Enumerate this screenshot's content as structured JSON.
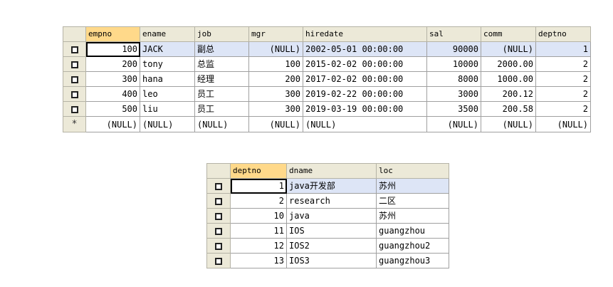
{
  "emp": {
    "columns": [
      "empno",
      "ename",
      "job",
      "mgr",
      "hiredate",
      "sal",
      "comm",
      "deptno"
    ],
    "rows": [
      [
        "100",
        "JACK",
        "副总",
        "(NULL)",
        "2002-05-01 00:00:00",
        "90000",
        "(NULL)",
        "1"
      ],
      [
        "200",
        "tony",
        "总监",
        "100",
        "2015-02-02 00:00:00",
        "10000",
        "2000.00",
        "2"
      ],
      [
        "300",
        "hana",
        "经理",
        "200",
        "2017-02-02 00:00:00",
        "8000",
        "1000.00",
        "2"
      ],
      [
        "400",
        "leo",
        "员工",
        "300",
        "2019-02-22 00:00:00",
        "3000",
        "200.12",
        "2"
      ],
      [
        "500",
        "liu",
        "员工",
        "300",
        "2019-03-19 00:00:00",
        "3500",
        "200.58",
        "2"
      ]
    ],
    "new_row_marker": "*",
    "new_row": [
      "(NULL)",
      "(NULL)",
      "(NULL)",
      "(NULL)",
      "(NULL)",
      "(NULL)",
      "(NULL)",
      "(NULL)"
    ]
  },
  "dept": {
    "columns": [
      "deptno",
      "dname",
      "loc"
    ],
    "rows": [
      [
        "1",
        "java开发部",
        "苏州"
      ],
      [
        "2",
        "research",
        "二区"
      ],
      [
        "10",
        "java",
        "苏州"
      ],
      [
        "11",
        "IOS",
        "guangzhou"
      ],
      [
        "12",
        "IOS2",
        "guangzhou2"
      ],
      [
        "13",
        "IOS3",
        "guangzhou3"
      ]
    ]
  },
  "colors": {
    "header_bg": "#ece9d8",
    "selected_header_bg": "#ffd98a",
    "selected_row_bg": "#dde5f6"
  }
}
